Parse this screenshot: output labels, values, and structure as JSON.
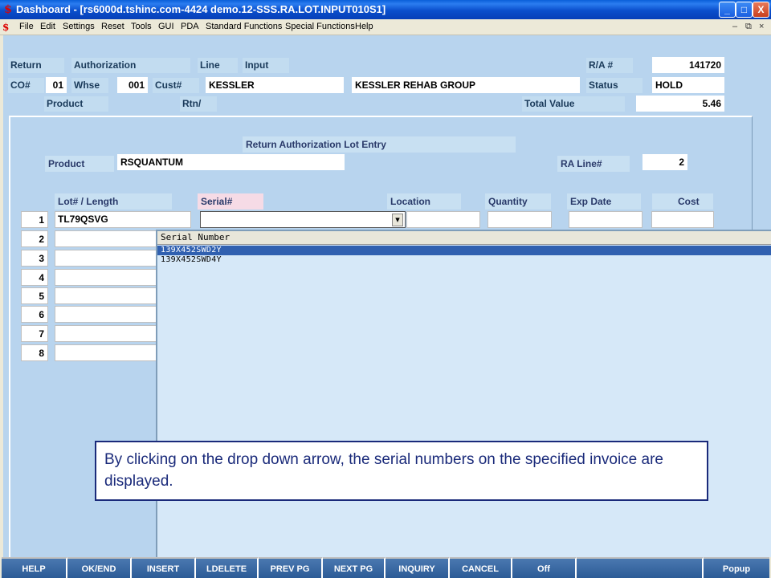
{
  "window": {
    "title": "Dashboard - [rs6000d.tshinc.com-4424 demo.12-SSS.RA.LOT.INPUT010S1]",
    "app_icon": "$",
    "minimize": "_",
    "maximize": "□",
    "close": "X"
  },
  "menu": {
    "icon": "$",
    "items": [
      "File",
      "Edit",
      "Settings",
      "Reset",
      "Tools",
      "GUI",
      "PDA",
      "Standard Functions",
      "Special Functions",
      "Help"
    ],
    "mdi_min": "–",
    "mdi_restore": "⧉",
    "mdi_close": "×"
  },
  "header": {
    "return_label": "Return",
    "authorization_label": "Authorization",
    "line_label": "Line",
    "input_label": "Input",
    "ra_label": "R/A #",
    "ra_value": "141720",
    "co_label": "CO#",
    "co_value": "01",
    "whse_label": "Whse",
    "whse_value": "001",
    "cust_label": "Cust#",
    "cust_value": "KESSLER",
    "cust_name": "KESSLER REHAB GROUP",
    "status_label": "Status",
    "status_value": "HOLD",
    "product_label": "Product",
    "rtn_label": "Rtn/",
    "total_value_label": "Total Value",
    "total_value": "5.46"
  },
  "lot_entry": {
    "title": "Return Authorization Lot Entry",
    "product_label": "Product",
    "product_value": "RSQUANTUM",
    "ra_line_label": "RA Line#",
    "ra_line_value": "2",
    "columns": {
      "lot": "Lot# / Length",
      "serial": "Serial#",
      "location": "Location",
      "quantity": "Quantity",
      "exp_date": "Exp Date",
      "cost": "Cost"
    },
    "row_numbers": [
      "1",
      "2",
      "3",
      "4",
      "5",
      "6",
      "7",
      "8"
    ],
    "row1_lot": "TL79QSVG",
    "dropdown_arrow": "▾"
  },
  "popup": {
    "header": "Serial Number",
    "items": [
      "139X452SWD2Y",
      "139X452SWD4Y"
    ]
  },
  "callout": {
    "text": "By clicking on the drop down arrow, the serial numbers on the specified invoice are displayed."
  },
  "fkeys": [
    "HELP",
    "OK/END",
    "INSERT",
    "LDELETE",
    "PREV PG",
    "NEXT PG",
    "INQUIRY",
    "CANCEL",
    "Off",
    "",
    "Popup"
  ],
  "colors": {
    "title_bar": "#0a4fcc",
    "main_bg": "#b8d4ee",
    "label_bg": "#c2dcf0",
    "fkey_bg": "#2c5b96",
    "selection": "#3060b0"
  }
}
